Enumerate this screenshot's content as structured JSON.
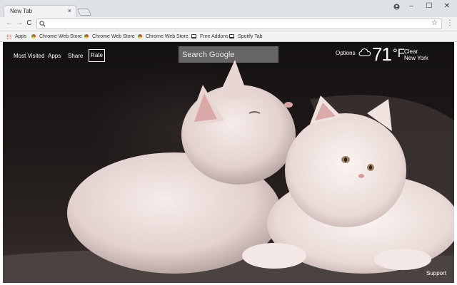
{
  "browser": {
    "tab_title": "New Tab",
    "tab_close": "×",
    "window_controls": {
      "minimize": "–",
      "maximize": "☐",
      "close": "✕"
    },
    "nav": {
      "back": "←",
      "forward": "→",
      "reload": "C"
    },
    "omnibox": {
      "value": "",
      "placeholder": ""
    },
    "star": "☆",
    "menu": "⋮"
  },
  "bookmarks": [
    {
      "label": "Apps",
      "icon": "apps-grid-icon"
    },
    {
      "label": "Chrome Web Store",
      "icon": "chrome-web-store-icon"
    },
    {
      "label": "Chrome Web Store",
      "icon": "chrome-web-store-icon"
    },
    {
      "label": "Chrome Web Store",
      "icon": "chrome-web-store-icon"
    },
    {
      "label": "Free Addons",
      "icon": "addons-icon"
    },
    {
      "label": "Spotify Tab",
      "icon": "addons-icon"
    }
  ],
  "newtab": {
    "links": {
      "most_visited": "Most Visited",
      "apps": "Apps",
      "share": "Share",
      "rate": "Rate"
    },
    "search": {
      "placeholder": "Search Google"
    },
    "options": "Options",
    "weather": {
      "icon": "cloud-icon",
      "temperature": "71",
      "unit": "°F",
      "condition": "Clear",
      "location": "New York"
    },
    "support": "Support"
  },
  "colors": {
    "titlebar": "#dfe3e8",
    "toolbar": "#f2f2f2",
    "page_text": "#ffffff"
  }
}
